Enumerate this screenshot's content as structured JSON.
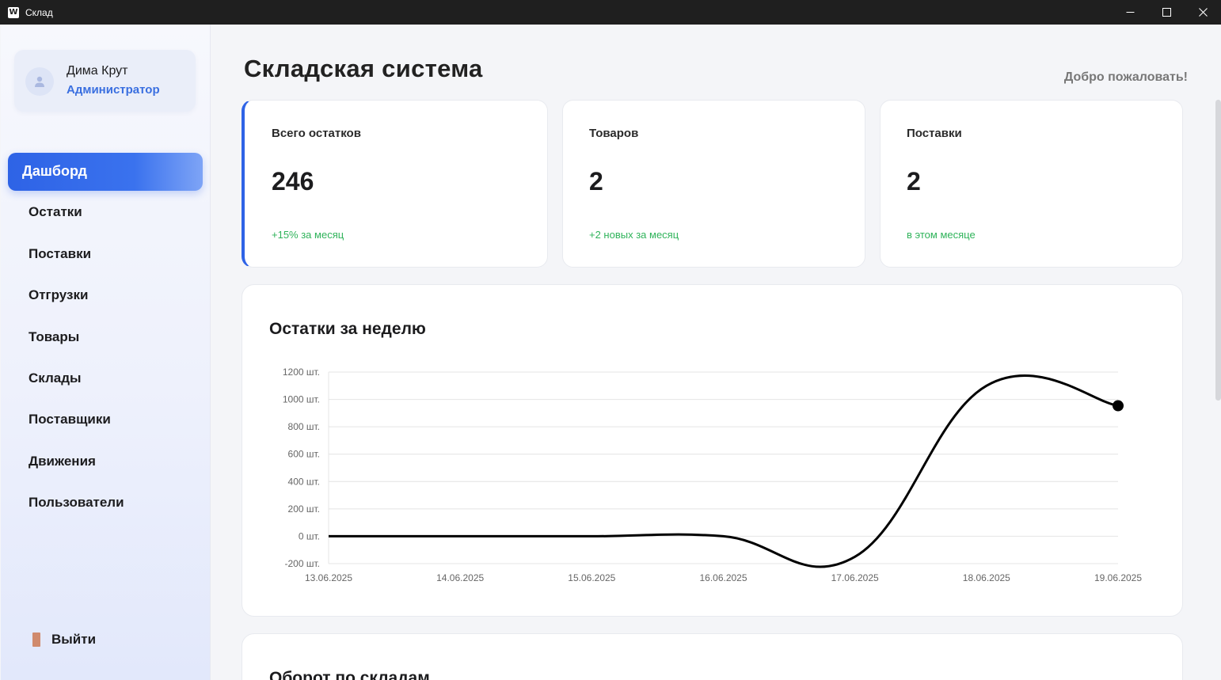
{
  "window": {
    "title": "Склад",
    "icon_letter": "W",
    "controls": [
      "minimize-icon",
      "maximize-icon",
      "close-icon"
    ]
  },
  "sidebar": {
    "profile": {
      "name": "Дима Крут",
      "role": "Администратор"
    },
    "items": [
      {
        "label": "Дашборд",
        "active": true
      },
      {
        "label": "Остатки"
      },
      {
        "label": "Поставки"
      },
      {
        "label": "Отгрузки"
      },
      {
        "label": "Товары"
      },
      {
        "label": "Склады"
      },
      {
        "label": "Поставщики"
      },
      {
        "label": "Движения"
      },
      {
        "label": "Пользователи"
      }
    ],
    "logout_label": "Выйти"
  },
  "header": {
    "title": "Складская система",
    "welcome": "Добро пожаловать!"
  },
  "stats": [
    {
      "label": "Всего остатков",
      "value": "246",
      "note": "+15% за месяц"
    },
    {
      "label": "Товаров",
      "value": "2",
      "note": "+2 новых за месяц"
    },
    {
      "label": "Поставки",
      "value": "2",
      "note": "в этом месяце"
    }
  ],
  "chart_title": "Остатки за неделю",
  "chart_data": {
    "type": "line",
    "categories": [
      "13.06.2025",
      "14.06.2025",
      "15.06.2025",
      "16.06.2025",
      "17.06.2025",
      "18.06.2025",
      "19.06.2025"
    ],
    "values": [
      0,
      0,
      0,
      0,
      -150,
      1100,
      954
    ],
    "ylim": [
      -200,
      1200
    ],
    "yticks": [
      "1200 шт.",
      "1000 шт.",
      "800 шт.",
      "600 шт.",
      "400 шт.",
      "200 шт.",
      "0 шт.",
      "-200 шт."
    ],
    "ytick_values": [
      1200,
      1000,
      800,
      600,
      400,
      200,
      0,
      -200
    ],
    "grid": true,
    "line_color": "#000000"
  },
  "second_card_title": "Оборот по складам"
}
